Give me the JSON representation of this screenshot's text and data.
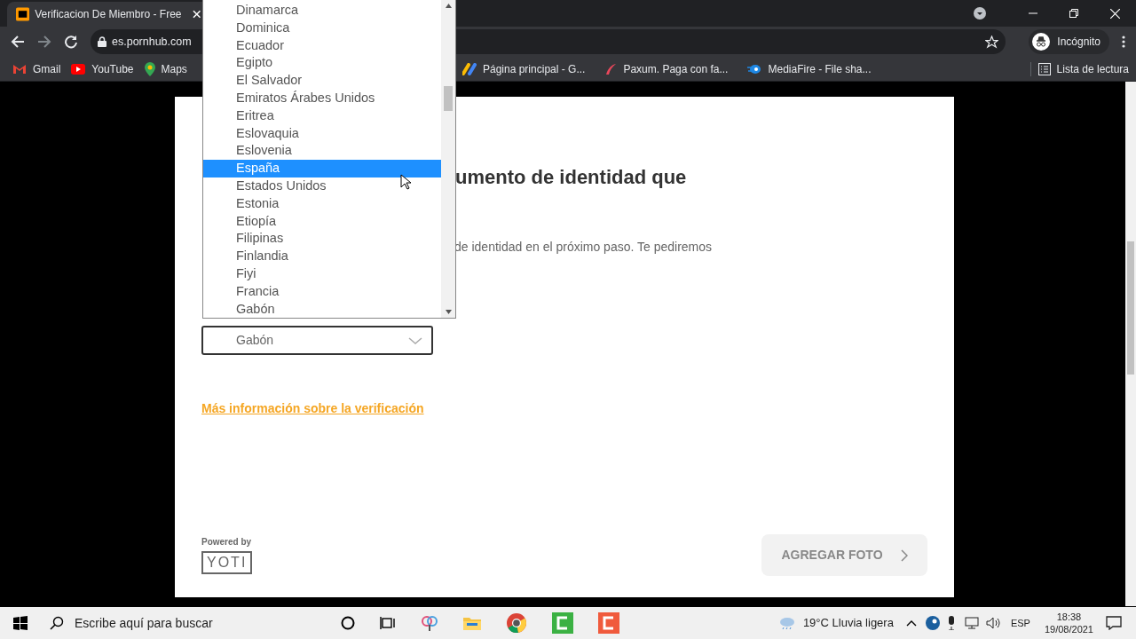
{
  "browser": {
    "tab": {
      "title": "Verificacion De Miembro - Free",
      "selected": true
    },
    "address": "es.pornhub.com",
    "profile": "Incógnito",
    "bookmarks": [
      {
        "label": "Gmail",
        "kind": "gmail"
      },
      {
        "label": "YouTube",
        "kind": "youtube"
      },
      {
        "label": "Maps",
        "kind": "maps"
      },
      {
        "label": "Página principal - G...",
        "kind": "ads"
      },
      {
        "label": "Paxum. Paga con fa...",
        "kind": "paxum"
      },
      {
        "label": "MediaFire - File sha...",
        "kind": "mediafire"
      }
    ],
    "reading_list": "Lista de lectura"
  },
  "page": {
    "heading": "umento de identidad que",
    "text": "de identidad en el próximo paso. Te pediremos",
    "select": {
      "value": "Gabón"
    },
    "link": "Más información sobre la verificación",
    "powered_by": "Powered by",
    "logo": "YOTI",
    "button": "AGREGAR FOTO"
  },
  "dropdown": {
    "options": [
      {
        "label": "Dinamarca",
        "selected": false
      },
      {
        "label": "Dominica",
        "selected": false
      },
      {
        "label": "Ecuador",
        "selected": false
      },
      {
        "label": "Egipto",
        "selected": false
      },
      {
        "label": "El Salvador",
        "selected": false
      },
      {
        "label": "Emiratos Árabes Unidos",
        "selected": false
      },
      {
        "label": "Eritrea",
        "selected": false
      },
      {
        "label": "Eslovaquia",
        "selected": false
      },
      {
        "label": "Eslovenia",
        "selected": false
      },
      {
        "label": "España",
        "selected": true
      },
      {
        "label": "Estados Unidos",
        "selected": false
      },
      {
        "label": "Estonia",
        "selected": false
      },
      {
        "label": "Etiopía",
        "selected": false
      },
      {
        "label": "Filipinas",
        "selected": false
      },
      {
        "label": "Finlandia",
        "selected": false
      },
      {
        "label": "Fiyi",
        "selected": false
      },
      {
        "label": "Francia",
        "selected": false
      },
      {
        "label": "Gabón",
        "selected": false
      }
    ]
  },
  "taskbar": {
    "search_placeholder": "Escribe aquí para buscar",
    "weather": "19°C Lluvia ligera",
    "language": "ESP",
    "time": "18:38",
    "date": "19/08/2021"
  }
}
